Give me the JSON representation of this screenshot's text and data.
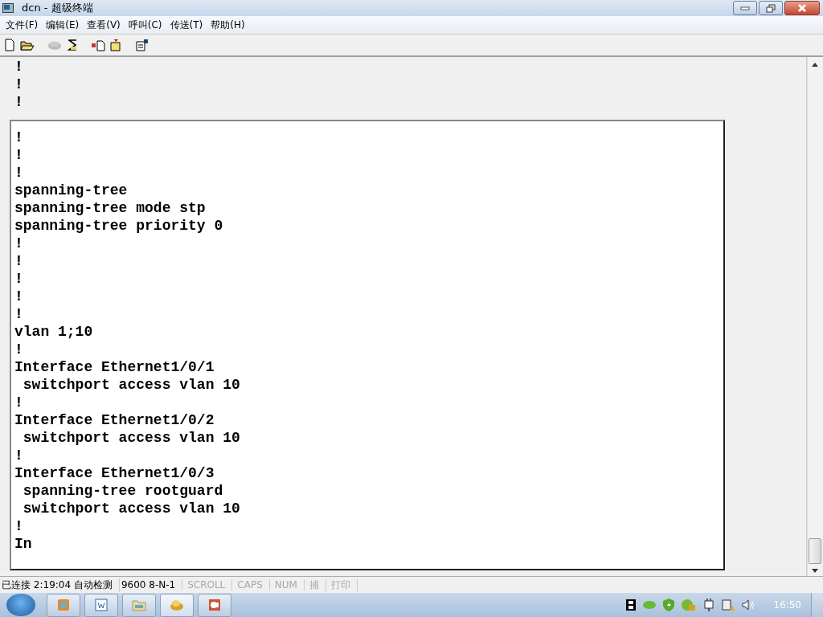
{
  "window": {
    "title": "dcn - 超级终端"
  },
  "menu": [
    {
      "label": "文件(F)"
    },
    {
      "label": "编辑(E)"
    },
    {
      "label": "查看(V)"
    },
    {
      "label": "呼叫(C)"
    },
    {
      "label": "传送(T)"
    },
    {
      "label": "帮助(H)"
    }
  ],
  "terminal": {
    "background_lines": [
      "!",
      "!",
      "!"
    ],
    "lines": [
      "!",
      "!",
      "!",
      "spanning-tree",
      "spanning-tree mode stp",
      "spanning-tree priority 0",
      "!",
      "!",
      "!",
      "!",
      "!",
      "vlan 1;10",
      "!",
      "Interface Ethernet1/0/1",
      " switchport access vlan 10",
      "!",
      "Interface Ethernet1/0/2",
      " switchport access vlan 10",
      "!",
      "Interface Ethernet1/0/3",
      " spanning-tree rootguard",
      " switchport access vlan 10",
      "!",
      "In"
    ]
  },
  "status_bar": [
    {
      "text": "已连接 2:19:04 自动检测",
      "disabled": false
    },
    {
      "text": "9600 8-N-1",
      "disabled": false
    },
    {
      "text": "SCROLL",
      "disabled": true
    },
    {
      "text": "CAPS",
      "disabled": true
    },
    {
      "text": "NUM",
      "disabled": true
    },
    {
      "text": "捕",
      "disabled": true
    },
    {
      "text": "打印",
      "disabled": true
    }
  ],
  "taskbar": {
    "time": "16:50"
  }
}
